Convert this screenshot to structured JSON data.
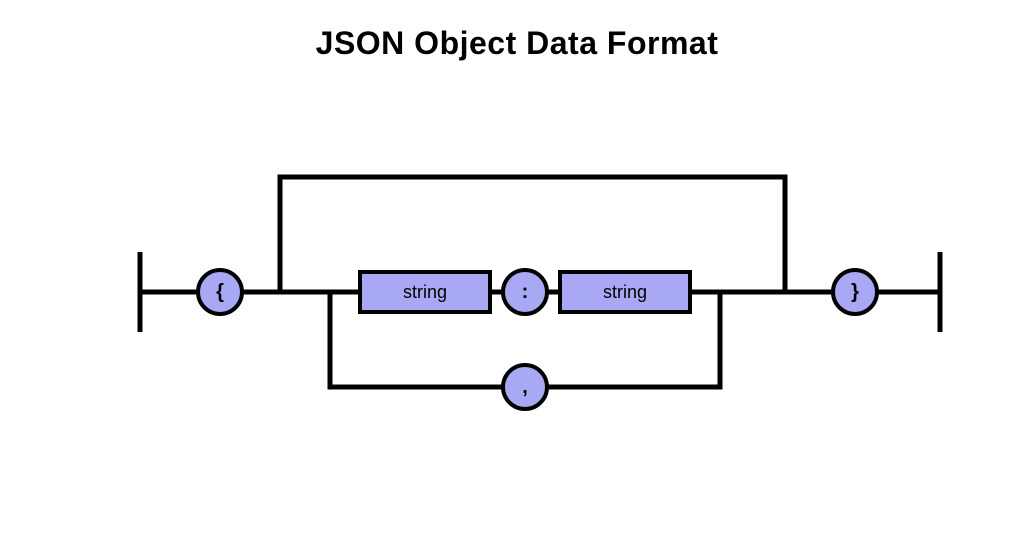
{
  "title": "JSON Object Data Format",
  "diagram": {
    "open_brace": "{",
    "close_brace": "}",
    "colon": ":",
    "comma": ",",
    "key_label": "string",
    "value_label": "string"
  }
}
